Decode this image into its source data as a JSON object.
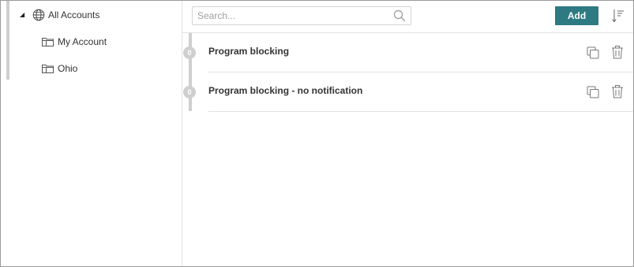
{
  "tree": {
    "root": {
      "label": "All Accounts",
      "icon": "globe-icon",
      "expanded": true
    },
    "children": [
      {
        "label": "My Account",
        "icon": "folder-icon"
      },
      {
        "label": "Ohio",
        "icon": "folder-icon"
      }
    ]
  },
  "toolbar": {
    "search_placeholder": "Search...",
    "search_value": "",
    "add_label": "Add",
    "sort_icon": "sort-icon"
  },
  "list": {
    "items": [
      {
        "count": "0",
        "title": "Program blocking"
      },
      {
        "count": "0",
        "title": "Program blocking - no notification"
      }
    ]
  },
  "colors": {
    "accent": "#2e7a82",
    "border": "#e2e2e2",
    "badge": "#cfcfcf",
    "text": "#333333"
  }
}
